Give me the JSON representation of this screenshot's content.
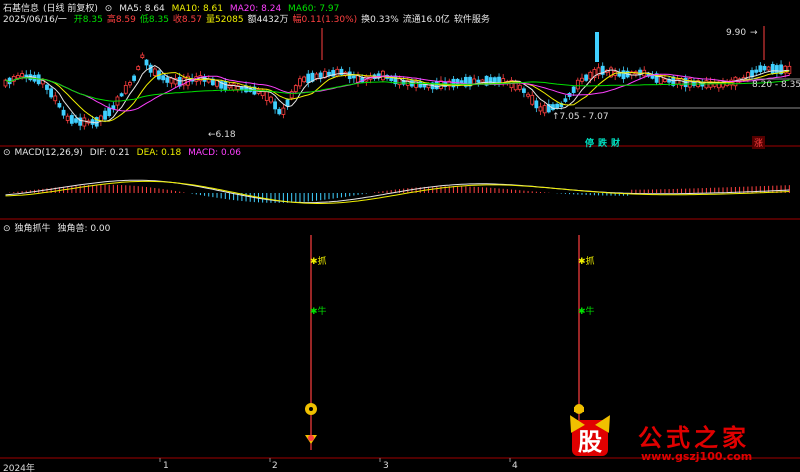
{
  "stock": {
    "name": "石基信息",
    "period": "(日线 前复权)"
  },
  "ma": {
    "ma5": "MA5: 8.64",
    "ma10": "MA10: 8.61",
    "ma20": "MA20: 8.24",
    "ma60": "MA60: 7.97"
  },
  "info": {
    "date": "2025/06/16/一",
    "open": "开8.35",
    "high": "高8.59",
    "low": "低8.35",
    "close": "收8.57",
    "volume": "量52085",
    "amount": "额4432万",
    "change": "幅0.11(1.30%)",
    "turnover": "换0.33%",
    "float": "流通16.0亿",
    "industry": "软件服务"
  },
  "price_labels": {
    "low_mark": "6.18",
    "range_mark": "7.05 - 7.07",
    "high_mark": "9.90",
    "level_mark": "8.20 - 8.35"
  },
  "badges": [
    "停",
    "跌",
    "财",
    "涨"
  ],
  "macd": {
    "title": "MACD(12,26,9)",
    "dif": "DIF: 0.21",
    "dea": "DEA: 0.18",
    "macd": "MACD: 0.06"
  },
  "indicator": {
    "title": "独角抓牛",
    "value": "独角兽: 0.00",
    "sig1": "抓",
    "sig2": "牛"
  },
  "xaxis": {
    "year": "2024年",
    "ticks": [
      "1",
      "2",
      "3",
      "4"
    ]
  },
  "watermark": {
    "text": "公式之家",
    "url": "www.gszj100.com",
    "logo": "股"
  },
  "colors": {
    "up": "#ff4040",
    "down": "#40d0ff",
    "ma5": "#e6e6e6",
    "ma10": "#f0f000",
    "ma20": "#ff40ff",
    "ma60": "#00e000",
    "divider": "#a00000"
  }
}
